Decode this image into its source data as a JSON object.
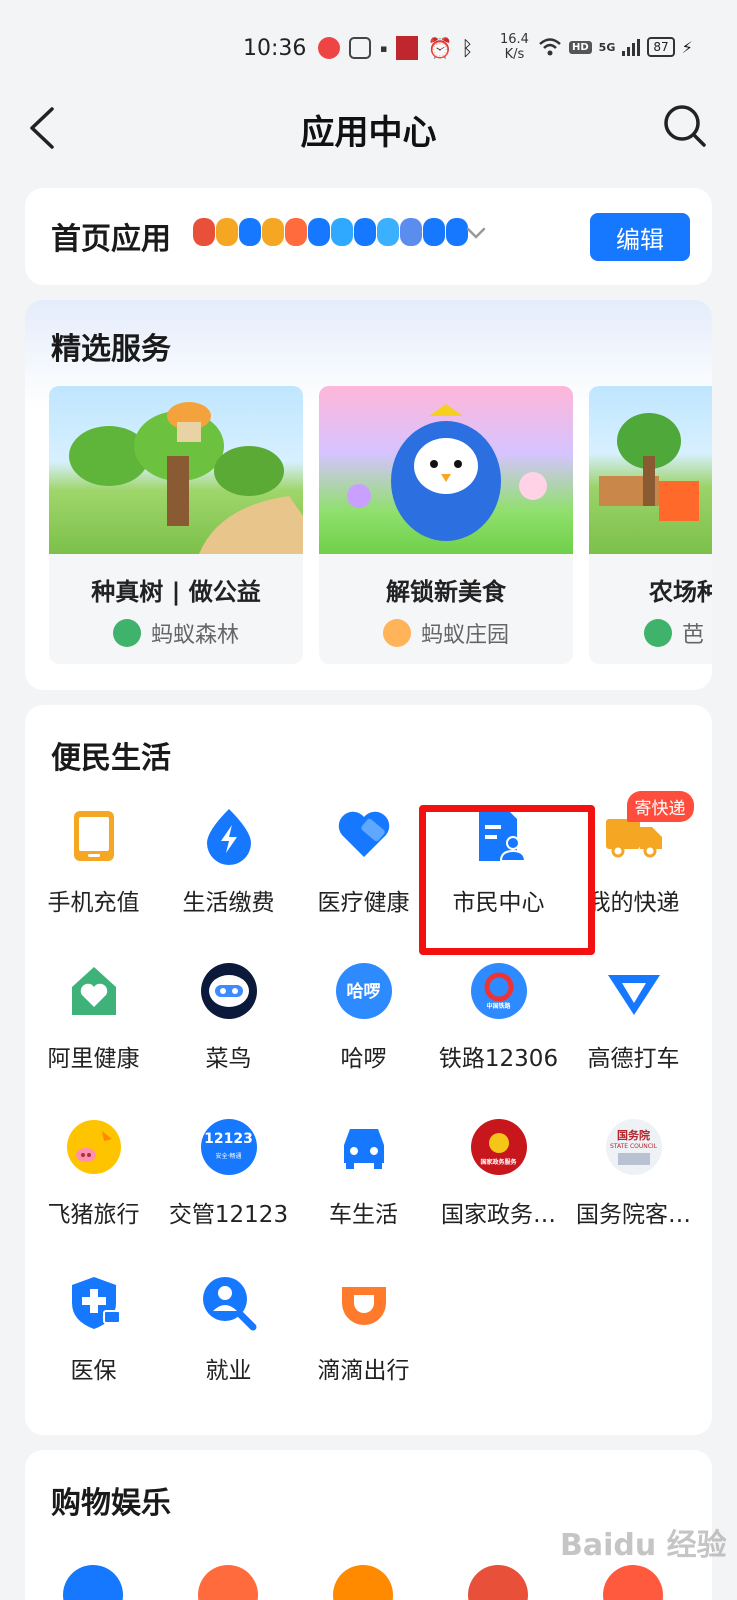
{
  "status_bar": {
    "time": "10:36",
    "net_speed_value": "16.4",
    "net_speed_unit": "K/s",
    "net_type": "HD",
    "signal": "5G",
    "battery": "87"
  },
  "header": {
    "title": "应用中心"
  },
  "home_apps": {
    "title": "首页应用",
    "edit_label": "编辑",
    "mini_icon_colors": [
      "#e8503a",
      "#f5a623",
      "#1677ff",
      "#f5a623",
      "#ff6b3d",
      "#1677ff",
      "#2fa8ff",
      "#1677ff",
      "#3ab0ff",
      "#5b8def",
      "#1677ff",
      "#1677ff"
    ]
  },
  "featured": {
    "title": "精选服务",
    "items": [
      {
        "name": "种真树 | 做公益",
        "source": "蚂蚁森林",
        "icon": "tree-icon"
      },
      {
        "name": "解锁新美食",
        "source": "蚂蚁庄园",
        "icon": "chick-icon"
      },
      {
        "name": "农场种",
        "source": "芭",
        "icon": "farm-icon"
      }
    ]
  },
  "life": {
    "title": "便民生活",
    "tiles": [
      {
        "label": "手机充值",
        "icon": "tablet-icon"
      },
      {
        "label": "生活缴费",
        "icon": "lightning-drop-icon"
      },
      {
        "label": "医疗健康",
        "icon": "heart-bandage-icon"
      },
      {
        "label": "市民中心",
        "icon": "citizen-document-icon"
      },
      {
        "label": "我的快递",
        "icon": "delivery-truck-icon",
        "badge": "寄快递"
      },
      {
        "label": "阿里健康",
        "icon": "house-heart-icon"
      },
      {
        "label": "菜鸟",
        "icon": "robot-icon"
      },
      {
        "label": "哈啰",
        "icon": "hello-icon",
        "icon_text": "哈啰"
      },
      {
        "label": "铁路12306",
        "icon": "railway-icon",
        "icon_text": "中国铁路"
      },
      {
        "label": "高德打车",
        "icon": "gaode-icon"
      },
      {
        "label": "飞猪旅行",
        "icon": "pig-icon"
      },
      {
        "label": "交管12123",
        "icon": "traffic-icon",
        "icon_text": "12123",
        "icon_subtext": "安全·畅通"
      },
      {
        "label": "车生活",
        "icon": "car-icon"
      },
      {
        "label": "国家政务…",
        "icon": "national-emblem-icon",
        "icon_text": "国家政务服务"
      },
      {
        "label": "国务院客…",
        "icon": "state-council-icon",
        "icon_text": "国务院",
        "icon_subtext": "STATE COUNCIL"
      },
      {
        "label": "医保",
        "icon": "medical-insurance-icon"
      },
      {
        "label": "就业",
        "icon": "job-search-icon"
      },
      {
        "label": "滴滴出行",
        "icon": "didi-icon"
      }
    ]
  },
  "shopping": {
    "title": "购物娱乐",
    "icon_colors": [
      "#1677ff",
      "#ff6b3d",
      "#ff8a00",
      "#e8503a",
      "#ff5a3d"
    ]
  },
  "watermark": "Baidu 经验"
}
